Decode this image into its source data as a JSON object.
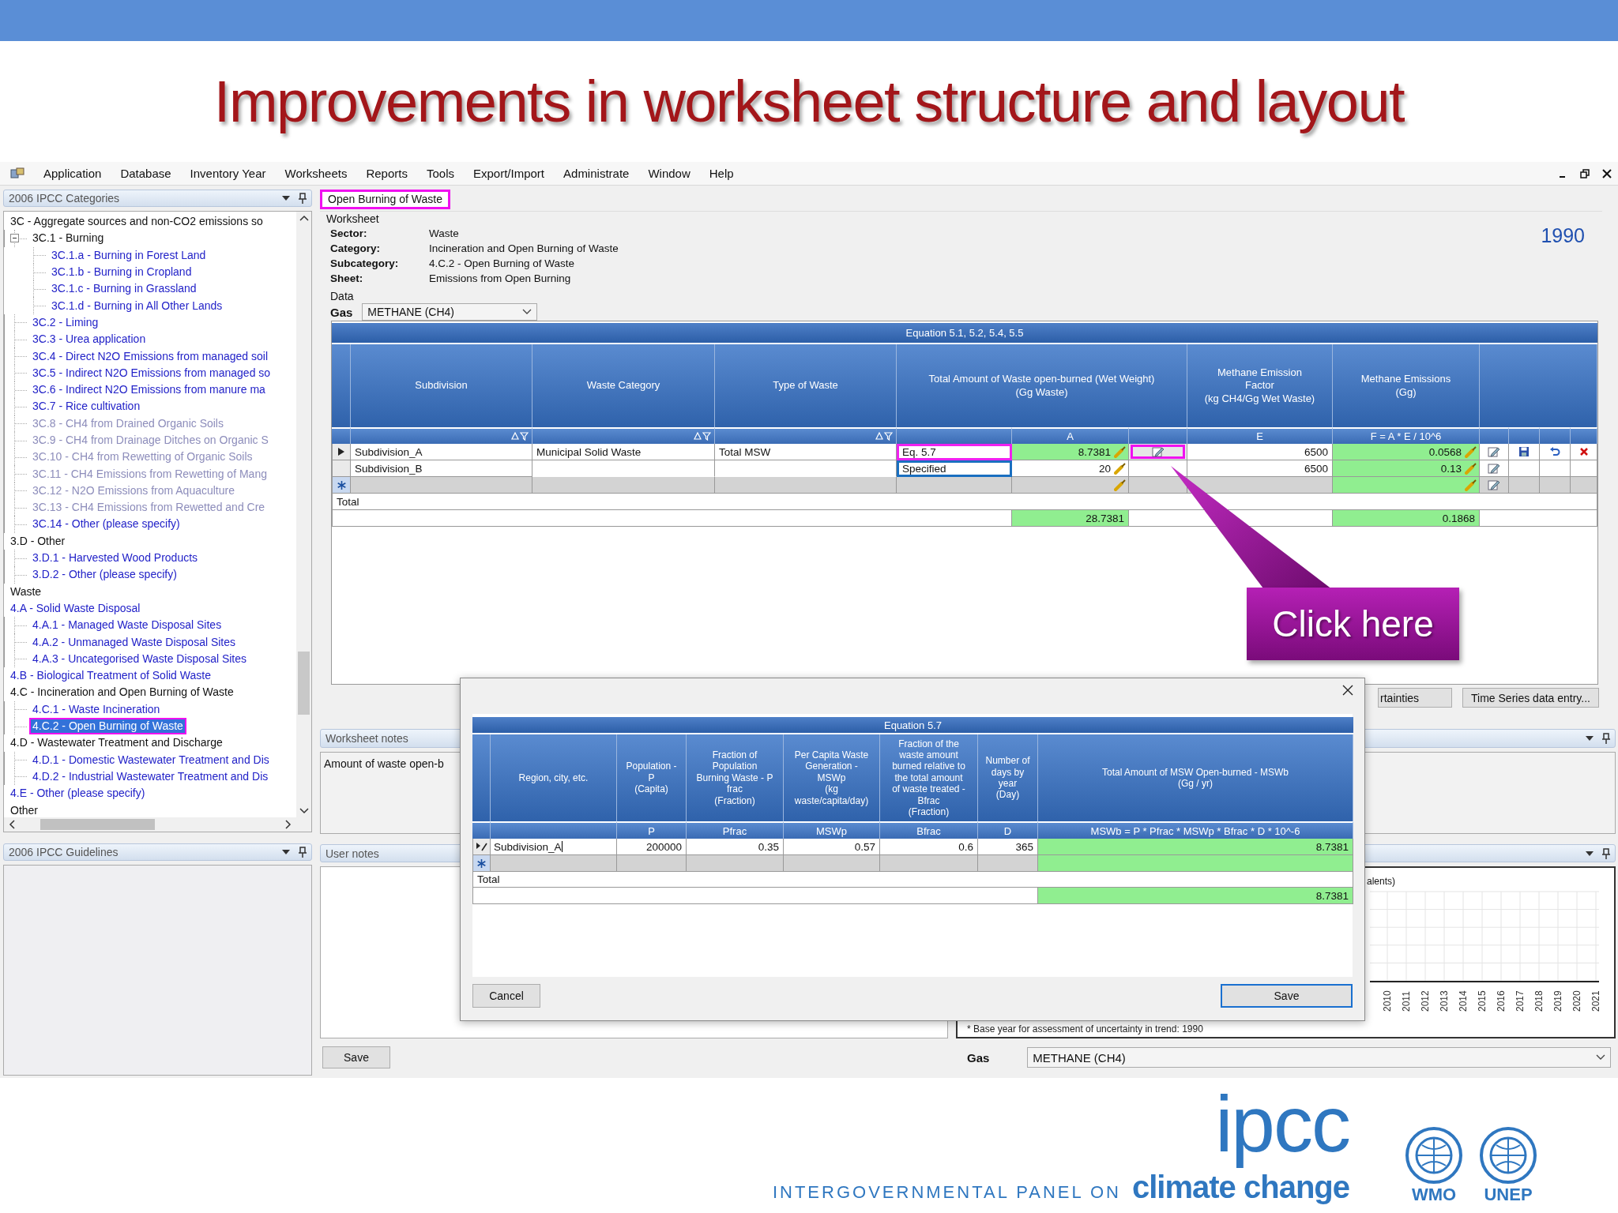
{
  "slide": {
    "title": "Improvements in worksheet structure and layout"
  },
  "menu": [
    {
      "label": "Application"
    },
    {
      "label": "Database"
    },
    {
      "label": "Inventory Year"
    },
    {
      "label": "Worksheets"
    },
    {
      "label": "Reports"
    },
    {
      "label": "Tools"
    },
    {
      "label": "Export/Import"
    },
    {
      "label": "Administrate"
    },
    {
      "label": "Window"
    },
    {
      "label": "Help"
    }
  ],
  "categories_panel": {
    "title": "2006 IPCC Categories",
    "tree": [
      {
        "label": "3C - Aggregate sources and non-CO2 emissions so",
        "kind": "group",
        "selected": false,
        "disabled": false,
        "highlighted": false,
        "children": [
          {
            "label": "3C.1 - Burning",
            "kind": "group",
            "expanded": true,
            "selected": false,
            "disabled": false,
            "highlighted": false,
            "children": [
              {
                "label": "3C.1.a - Burning in Forest Land",
                "kind": "sheet",
                "selected": false,
                "disabled": false,
                "highlighted": false
              },
              {
                "label": "3C.1.b - Burning in Cropland",
                "kind": "sheet",
                "selected": false,
                "disabled": false,
                "highlighted": false
              },
              {
                "label": "3C.1.c - Burning in Grassland",
                "kind": "sheet",
                "selected": false,
                "disabled": false,
                "highlighted": false
              },
              {
                "label": "3C.1.d - Burning in All Other Lands",
                "kind": "sheet",
                "selected": false,
                "disabled": false,
                "highlighted": false
              }
            ]
          },
          {
            "label": "3C.2 - Liming",
            "kind": "sheet",
            "selected": false,
            "disabled": false,
            "highlighted": false
          },
          {
            "label": "3C.3 - Urea application",
            "kind": "sheet",
            "selected": false,
            "disabled": false,
            "highlighted": false
          },
          {
            "label": "3C.4 - Direct N2O Emissions from managed soil",
            "kind": "sheet",
            "selected": false,
            "disabled": false,
            "highlighted": false
          },
          {
            "label": "3C.5 - Indirect N2O Emissions from managed so",
            "kind": "sheet",
            "selected": false,
            "disabled": false,
            "highlighted": false
          },
          {
            "label": "3C.6 - Indirect N2O Emissions from manure ma",
            "kind": "sheet",
            "selected": false,
            "disabled": false,
            "highlighted": false
          },
          {
            "label": "3C.7 - Rice cultivation",
            "kind": "sheet",
            "selected": false,
            "disabled": false,
            "highlighted": false
          },
          {
            "label": "3C.8 - CH4 from Drained Organic Soils",
            "kind": "sheet",
            "selected": false,
            "disabled": true,
            "highlighted": false
          },
          {
            "label": "3C.9 - CH4 from Drainage Ditches on Organic S",
            "kind": "sheet",
            "selected": false,
            "disabled": true,
            "highlighted": false
          },
          {
            "label": "3C.10 - CH4 from Rewetting of Organic Soils",
            "kind": "sheet",
            "selected": false,
            "disabled": true,
            "highlighted": false
          },
          {
            "label": "3C.11 - CH4 Emissions from Rewetting of Mang",
            "kind": "sheet",
            "selected": false,
            "disabled": true,
            "highlighted": false
          },
          {
            "label": "3C.12 - N2O Emissions from Aquaculture",
            "kind": "sheet",
            "selected": false,
            "disabled": true,
            "highlighted": false
          },
          {
            "label": "3C.13 - CH4 Emissions from Rewetted and Cre",
            "kind": "sheet",
            "selected": false,
            "disabled": true,
            "highlighted": false
          },
          {
            "label": "3C.14 - Other (please specify)",
            "kind": "sheet",
            "selected": false,
            "disabled": false,
            "highlighted": false
          }
        ]
      },
      {
        "label": "3.D - Other",
        "kind": "group",
        "selected": false,
        "disabled": false,
        "highlighted": false,
        "children": [
          {
            "label": "3.D.1 - Harvested Wood Products",
            "kind": "sheet",
            "selected": false,
            "disabled": false,
            "highlighted": false
          },
          {
            "label": "3.D.2 - Other (please specify)",
            "kind": "sheet",
            "selected": false,
            "disabled": false,
            "highlighted": false
          }
        ]
      },
      {
        "label": "Waste",
        "kind": "group",
        "selected": false,
        "disabled": false,
        "highlighted": false
      },
      {
        "label": "4.A - Solid Waste Disposal",
        "kind": "sheet",
        "selected": false,
        "disabled": false,
        "highlighted": false,
        "children": [
          {
            "label": "4.A.1 - Managed Waste Disposal Sites",
            "kind": "sheet",
            "selected": false,
            "disabled": false,
            "highlighted": false
          },
          {
            "label": "4.A.2 - Unmanaged Waste Disposal Sites",
            "kind": "sheet",
            "selected": false,
            "disabled": false,
            "highlighted": false
          },
          {
            "label": "4.A.3 - Uncategorised Waste Disposal Sites",
            "kind": "sheet",
            "selected": false,
            "disabled": false,
            "highlighted": false
          }
        ]
      },
      {
        "label": "4.B - Biological Treatment of Solid Waste",
        "kind": "sheet",
        "selected": false,
        "disabled": false,
        "highlighted": false
      },
      {
        "label": "4.C - Incineration and Open Burning of Waste",
        "kind": "group",
        "selected": false,
        "disabled": false,
        "highlighted": false,
        "children": [
          {
            "label": "4.C.1 - Waste Incineration",
            "kind": "sheet",
            "selected": false,
            "disabled": false,
            "highlighted": false
          },
          {
            "label": "4.C.2 - Open Burning of Waste",
            "kind": "sheet",
            "selected": true,
            "disabled": false,
            "highlighted": true
          }
        ]
      },
      {
        "label": "4.D - Wastewater Treatment and Discharge",
        "kind": "group",
        "selected": false,
        "disabled": false,
        "highlighted": false,
        "children": [
          {
            "label": "4.D.1 - Domestic Wastewater Treatment and Dis",
            "kind": "sheet",
            "selected": false,
            "disabled": false,
            "highlighted": false
          },
          {
            "label": "4.D.2 - Industrial Wastewater Treatment and Dis",
            "kind": "sheet",
            "selected": false,
            "disabled": false,
            "highlighted": false
          }
        ]
      },
      {
        "label": "4.E - Other (please specify)",
        "kind": "sheet",
        "selected": false,
        "disabled": false,
        "highlighted": false
      },
      {
        "label": "Other",
        "kind": "group",
        "selected": false,
        "disabled": false,
        "highlighted": false
      }
    ]
  },
  "guidelines_panel": {
    "title": "2006 IPCC Guidelines"
  },
  "document_tab": {
    "label": "Open Burning of Waste",
    "highlighted": true
  },
  "worksheet": {
    "group_label": "Worksheet",
    "fields": [
      {
        "label": "Sector:",
        "value": "Waste"
      },
      {
        "label": "Category:",
        "value": "Incineration and Open Burning of Waste"
      },
      {
        "label": "Subcategory:",
        "value": "4.C.2 - Open Burning of Waste"
      },
      {
        "label": "Sheet:",
        "value": "Emissions from Open Burning"
      }
    ],
    "year": "1990",
    "data_label": "Data",
    "gas_label": "Gas",
    "gas": "METHANE (CH4)"
  },
  "grid": {
    "equation": "Equation 5.1, 5.2, 5.4, 5.5",
    "columns": [
      {
        "header": "Subdivision",
        "filterable": true
      },
      {
        "header": "Waste Category",
        "filterable": true
      },
      {
        "header": "Type of Waste",
        "filterable": true
      },
      {
        "header": "Total Amount of Waste open-burned (Wet Weight)\n(Gg Waste)",
        "symbol": "A"
      },
      {
        "header": "Methane Emission\nFactor\n(kg CH4/Gg Wet Waste)",
        "symbol": "E"
      },
      {
        "header": "Methane Emissions\n(Gg)",
        "symbol": "F = A * E / 10^6"
      }
    ],
    "rows": [
      {
        "kind": "data",
        "current": true,
        "subdivision": "Subdivision_A",
        "waste_category": "Municipal Solid Waste",
        "type": "Total MSW",
        "method": {
          "text": "Eq. 5.7",
          "color": "#f020f0"
        },
        "amount": "8.7381",
        "amount_calculated": true,
        "equation_button": {
          "highlighted": true
        },
        "ef": "6500",
        "emissions": "0.0568",
        "actions": [
          {
            "kind": "edit"
          },
          {
            "kind": "save"
          },
          {
            "kind": "undo"
          },
          {
            "kind": "delete"
          }
        ]
      },
      {
        "kind": "data",
        "current": false,
        "subdivision": "Subdivision_B",
        "method": {
          "text": "Specified",
          "color": "#1a6fc0"
        },
        "amount": "20",
        "amount_calculated": false,
        "ef": "6500",
        "emissions": "0.13",
        "actions": [
          {
            "kind": "edit"
          }
        ]
      },
      {
        "kind": "new",
        "actions": [
          {
            "kind": "edit"
          }
        ]
      }
    ],
    "total_label": "Total",
    "total_amount": "28.7381",
    "total_emissions": "0.1868"
  },
  "buttons": [
    {
      "label": "rtainties"
    },
    {
      "label": "Time Series data entry..."
    }
  ],
  "worksheet_notes": {
    "title": "Worksheet notes",
    "text": "Amount of waste open-b"
  },
  "user_notes": {
    "title": "User notes",
    "save": "Save"
  },
  "trend_panel": {
    "title_fragment": "alents)",
    "years": [
      "2010",
      "2011",
      "2012",
      "2013",
      "2014",
      "2015",
      "2016",
      "2017",
      "2018",
      "2019",
      "2020",
      "2021"
    ],
    "footnote": "* Base year for assessment of uncertainty in trend: 1990",
    "gas_label": "Gas",
    "gas": "METHANE (CH4)"
  },
  "dialog": {
    "equation": "Equation 5.7",
    "columns": [
      {
        "header": "Region, city, etc."
      },
      {
        "header": "Population -\nP\n(Capita)",
        "symbol": "P"
      },
      {
        "header": "Fraction of\nPopulation\nBurning Waste - P\nfrac\n(Fraction)",
        "symbol": "Pfrac"
      },
      {
        "header": "Per Capita Waste\nGeneration   -\nMSWp\n(kg\nwaste/capita/day)",
        "symbol": "MSWp"
      },
      {
        "header": "Fraction of the\nwaste amount\nburned relative to\nthe total amount\nof waste treated -\nBfrac\n(Fraction)",
        "symbol": "Bfrac"
      },
      {
        "header": "Number of\ndays by\nyear\n(Day)",
        "symbol": "D"
      },
      {
        "header": "Total Amount of MSW Open-burned   - MSWb\n(Gg / yr)",
        "symbol": "MSWb = P * Pfrac * MSWp * Bfrac * D * 10^-6"
      }
    ],
    "rows": [
      {
        "kind": "editing",
        "cells": [
          "Subdivision_A",
          "200000",
          "0.35",
          "0.57",
          "0.6",
          "365",
          "8.7381"
        ]
      },
      {
        "kind": "new"
      }
    ],
    "total_label": "Total",
    "total": "8.7381",
    "cancel": "Cancel",
    "save": "Save"
  },
  "callout": {
    "text": "Click here"
  },
  "branding": {
    "logo": "ipcc",
    "tagline": "INTERGOVERNMENTAL PANEL ON",
    "tagline_emphasis": "climate change",
    "partners": [
      "WMO",
      "UNEP"
    ]
  }
}
